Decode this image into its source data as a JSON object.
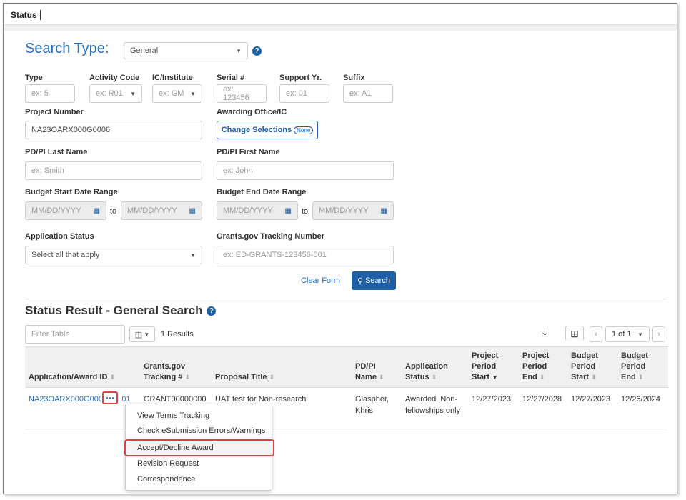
{
  "tab": {
    "label": "Status"
  },
  "search_type": {
    "label": "Search Type:",
    "selected": "General"
  },
  "fields": {
    "type": {
      "label": "Type",
      "placeholder": "ex: 5"
    },
    "activity_code": {
      "label": "Activity Code",
      "placeholder": "ex: R01"
    },
    "ic_institute": {
      "label": "IC/Institute",
      "placeholder": "ex: GM"
    },
    "serial": {
      "label": "Serial #",
      "placeholder": "ex: 123456"
    },
    "support_yr": {
      "label": "Support Yr.",
      "placeholder": "ex: 01"
    },
    "suffix": {
      "label": "Suffix",
      "placeholder": "ex: A1"
    },
    "project_number": {
      "label": "Project Number",
      "value": "NA23OARX000G0006"
    },
    "awarding_office": {
      "label": "Awarding Office/IC",
      "button": "Change Selections",
      "badge": "None"
    },
    "pdpi_last": {
      "label": "PD/PI Last Name",
      "placeholder": "ex: Smith"
    },
    "pdpi_first": {
      "label": "PD/PI First Name",
      "placeholder": "ex: John"
    },
    "budget_start": {
      "label": "Budget Start Date Range",
      "from": "MM/DD/YYYY",
      "to_text": "to",
      "to": "MM/DD/YYYY"
    },
    "budget_end": {
      "label": "Budget End Date Range",
      "from": "MM/DD/YYYY",
      "to_text": "to",
      "to": "MM/DD/YYYY"
    },
    "app_status": {
      "label": "Application Status",
      "placeholder": "Select all that apply"
    },
    "grants_tracking": {
      "label": "Grants.gov Tracking Number",
      "placeholder": "ex: ED-GRANTS-123456-001"
    }
  },
  "actions": {
    "clear": "Clear Form",
    "search": "Search"
  },
  "results": {
    "title": "Status Result - General Search",
    "filter_placeholder": "Filter Table",
    "count": "1 Results",
    "pager": "1 of 1",
    "columns": [
      "Application/Award ID",
      "Grants.gov Tracking #",
      "Proposal Title",
      "PD/PI Name",
      "Application Status",
      "Project Period Start",
      "Project Period End",
      "Budget Period Start",
      "Budget Period End"
    ],
    "rows": [
      {
        "id": "NA23OARX000G0006-T1-01",
        "tracking": "GRANT00000000",
        "title": "UAT test for Non-research",
        "pdpi_1": "Glaspher,",
        "pdpi_2": "Khris",
        "status_1": "Awarded. Non-",
        "status_2": "fellowships only",
        "proj_start": "12/27/2023",
        "proj_end": "12/27/2028",
        "budget_start": "12/27/2023",
        "budget_end": "12/26/2024"
      }
    ]
  },
  "menu": {
    "items": [
      "View Terms Tracking",
      "Check eSubmission Errors/Warnings",
      "Accept/Decline Award",
      "Revision Request",
      "Correspondence"
    ]
  }
}
